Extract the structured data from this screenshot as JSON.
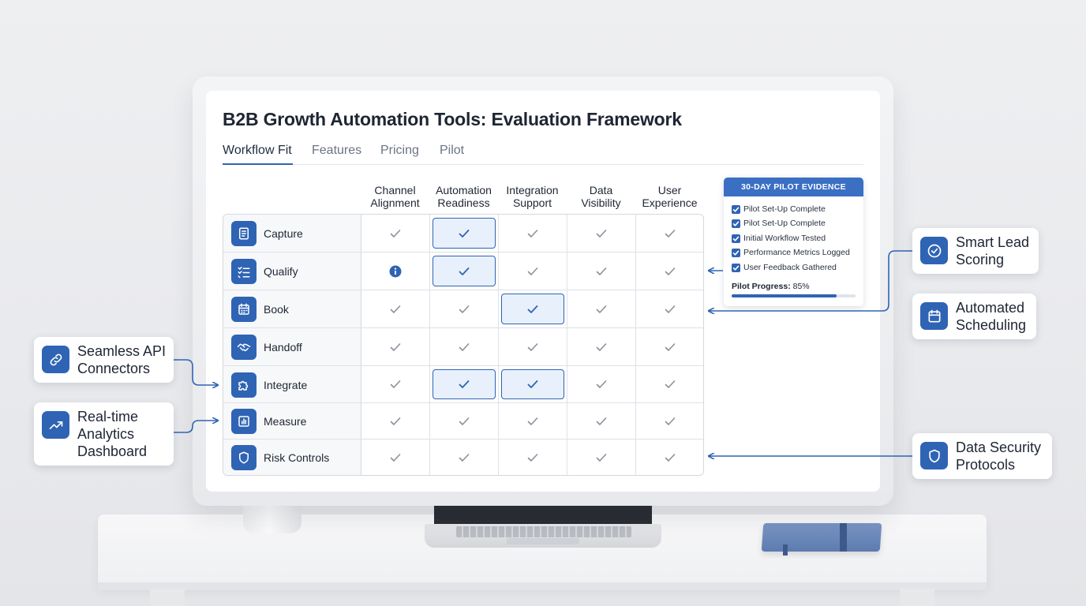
{
  "page": {
    "title": "B2B Growth Automation Tools: Evaluation Framework",
    "tabs": [
      {
        "label": "Workflow Fit",
        "active": true
      },
      {
        "label": "Features",
        "active": false
      },
      {
        "label": "Pricing",
        "active": false
      },
      {
        "label": "Pilot",
        "active": false
      }
    ]
  },
  "matrix": {
    "columns": [
      {
        "line1": "Channel",
        "line2": "Alignment"
      },
      {
        "line1": "Automation",
        "line2": "Readiness"
      },
      {
        "line1": "Integration",
        "line2": "Support"
      },
      {
        "line1": "Data",
        "line2": "Visibility"
      },
      {
        "line1": "User",
        "line2": "Experience"
      }
    ],
    "rows": [
      {
        "label": "Capture",
        "icon": "document-icon",
        "cells": [
          "check",
          "check-highlight",
          "check",
          "check",
          "check"
        ]
      },
      {
        "label": "Qualify",
        "icon": "checklist-icon",
        "cells": [
          "info",
          "check-highlight",
          "check",
          "check",
          "check"
        ]
      },
      {
        "label": "Book",
        "icon": "calendar-icon",
        "cells": [
          "check",
          "check",
          "check-highlight",
          "check",
          "check"
        ]
      },
      {
        "label": "Handoff",
        "icon": "handshake-icon",
        "cells": [
          "check",
          "check",
          "check",
          "check",
          "check"
        ]
      },
      {
        "label": "Integrate",
        "icon": "puzzle-icon",
        "cells": [
          "check",
          "check-highlight",
          "check-highlight",
          "check",
          "check"
        ]
      },
      {
        "label": "Measure",
        "icon": "bar-chart-icon",
        "cells": [
          "check",
          "check",
          "check",
          "check",
          "check"
        ]
      },
      {
        "label": "Risk Controls",
        "icon": "shield-icon",
        "cells": [
          "check",
          "check",
          "check",
          "check",
          "check"
        ]
      }
    ]
  },
  "pilot": {
    "title": "30-DAY PILOT EVIDENCE",
    "items": [
      "Pilot Set-Up Complete",
      "Pilot Set-Up Complete",
      "Initial Workflow Tested",
      "Performance Metrics Logged",
      "User Feedback Gathered"
    ],
    "progress_label": "Pilot Progress:",
    "progress_value": "85%",
    "progress_fraction": 0.85
  },
  "callouts": {
    "left": [
      {
        "line1": "Seamless API",
        "line2": "Connectors",
        "icon": "link-icon"
      },
      {
        "line1": "Real-time",
        "line2": "Analytics",
        "line3": "Dashboard",
        "icon": "trend-icon"
      }
    ],
    "right": [
      {
        "line1": "Smart Lead",
        "line2": "Scoring",
        "icon": "check-circle-icon"
      },
      {
        "line1": "Automated",
        "line2": "Scheduling",
        "icon": "calendar-icon"
      },
      {
        "line1": "Data Security",
        "line2": "Protocols",
        "icon": "shield-icon"
      }
    ]
  },
  "colors": {
    "accent": "#2f64b4",
    "accent_light": "#e8f0fb",
    "pilot_header": "#3a6fc4",
    "check_gray": "#8a919c"
  }
}
